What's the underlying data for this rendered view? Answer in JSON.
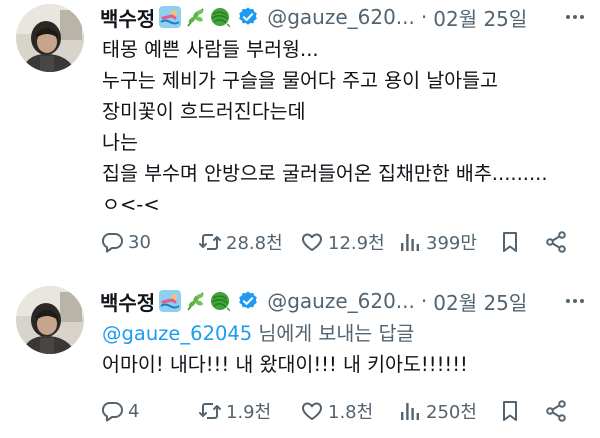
{
  "tweets": [
    {
      "author_name": "백수정",
      "handle": "@gauze_620...",
      "separator": "·",
      "date": "02월 25일",
      "emojis": [
        "swimmer-icon",
        "herb-icon",
        "yarn-ball-icon"
      ],
      "lines": [
        "태몽 예쁜 사람들 부러웡...",
        "누구는 제비가 구슬을 물어다 주고 용이 날아들고",
        "장미꽃이 흐드러진다는데",
        "나는",
        "집을 부수며 안방으로 굴러들어온 집채만한 배추.........",
        "ㅇ<-<"
      ],
      "actions": {
        "replies": "30",
        "retweets": "28.8천",
        "likes": "12.9천",
        "views": "399만"
      }
    },
    {
      "author_name": "백수정",
      "handle": "@gauze_620...",
      "separator": "·",
      "date": "02월 25일",
      "emojis": [
        "swimmer-icon",
        "herb-icon",
        "yarn-ball-icon"
      ],
      "reply_to": {
        "mention": "@gauze_62045",
        "suffix": " 님에게 보내는 답글"
      },
      "lines": [
        "어마이! 내다!!! 내 왔대이!!! 내 키아도!!!!!!"
      ],
      "actions": {
        "replies": "4",
        "retweets": "1.9천",
        "likes": "1.8천",
        "views": "250천"
      }
    }
  ],
  "colors": {
    "text": "#0f1419",
    "secondary": "#536471",
    "link": "#1d9bf0",
    "verified": "#1d9bf0"
  }
}
